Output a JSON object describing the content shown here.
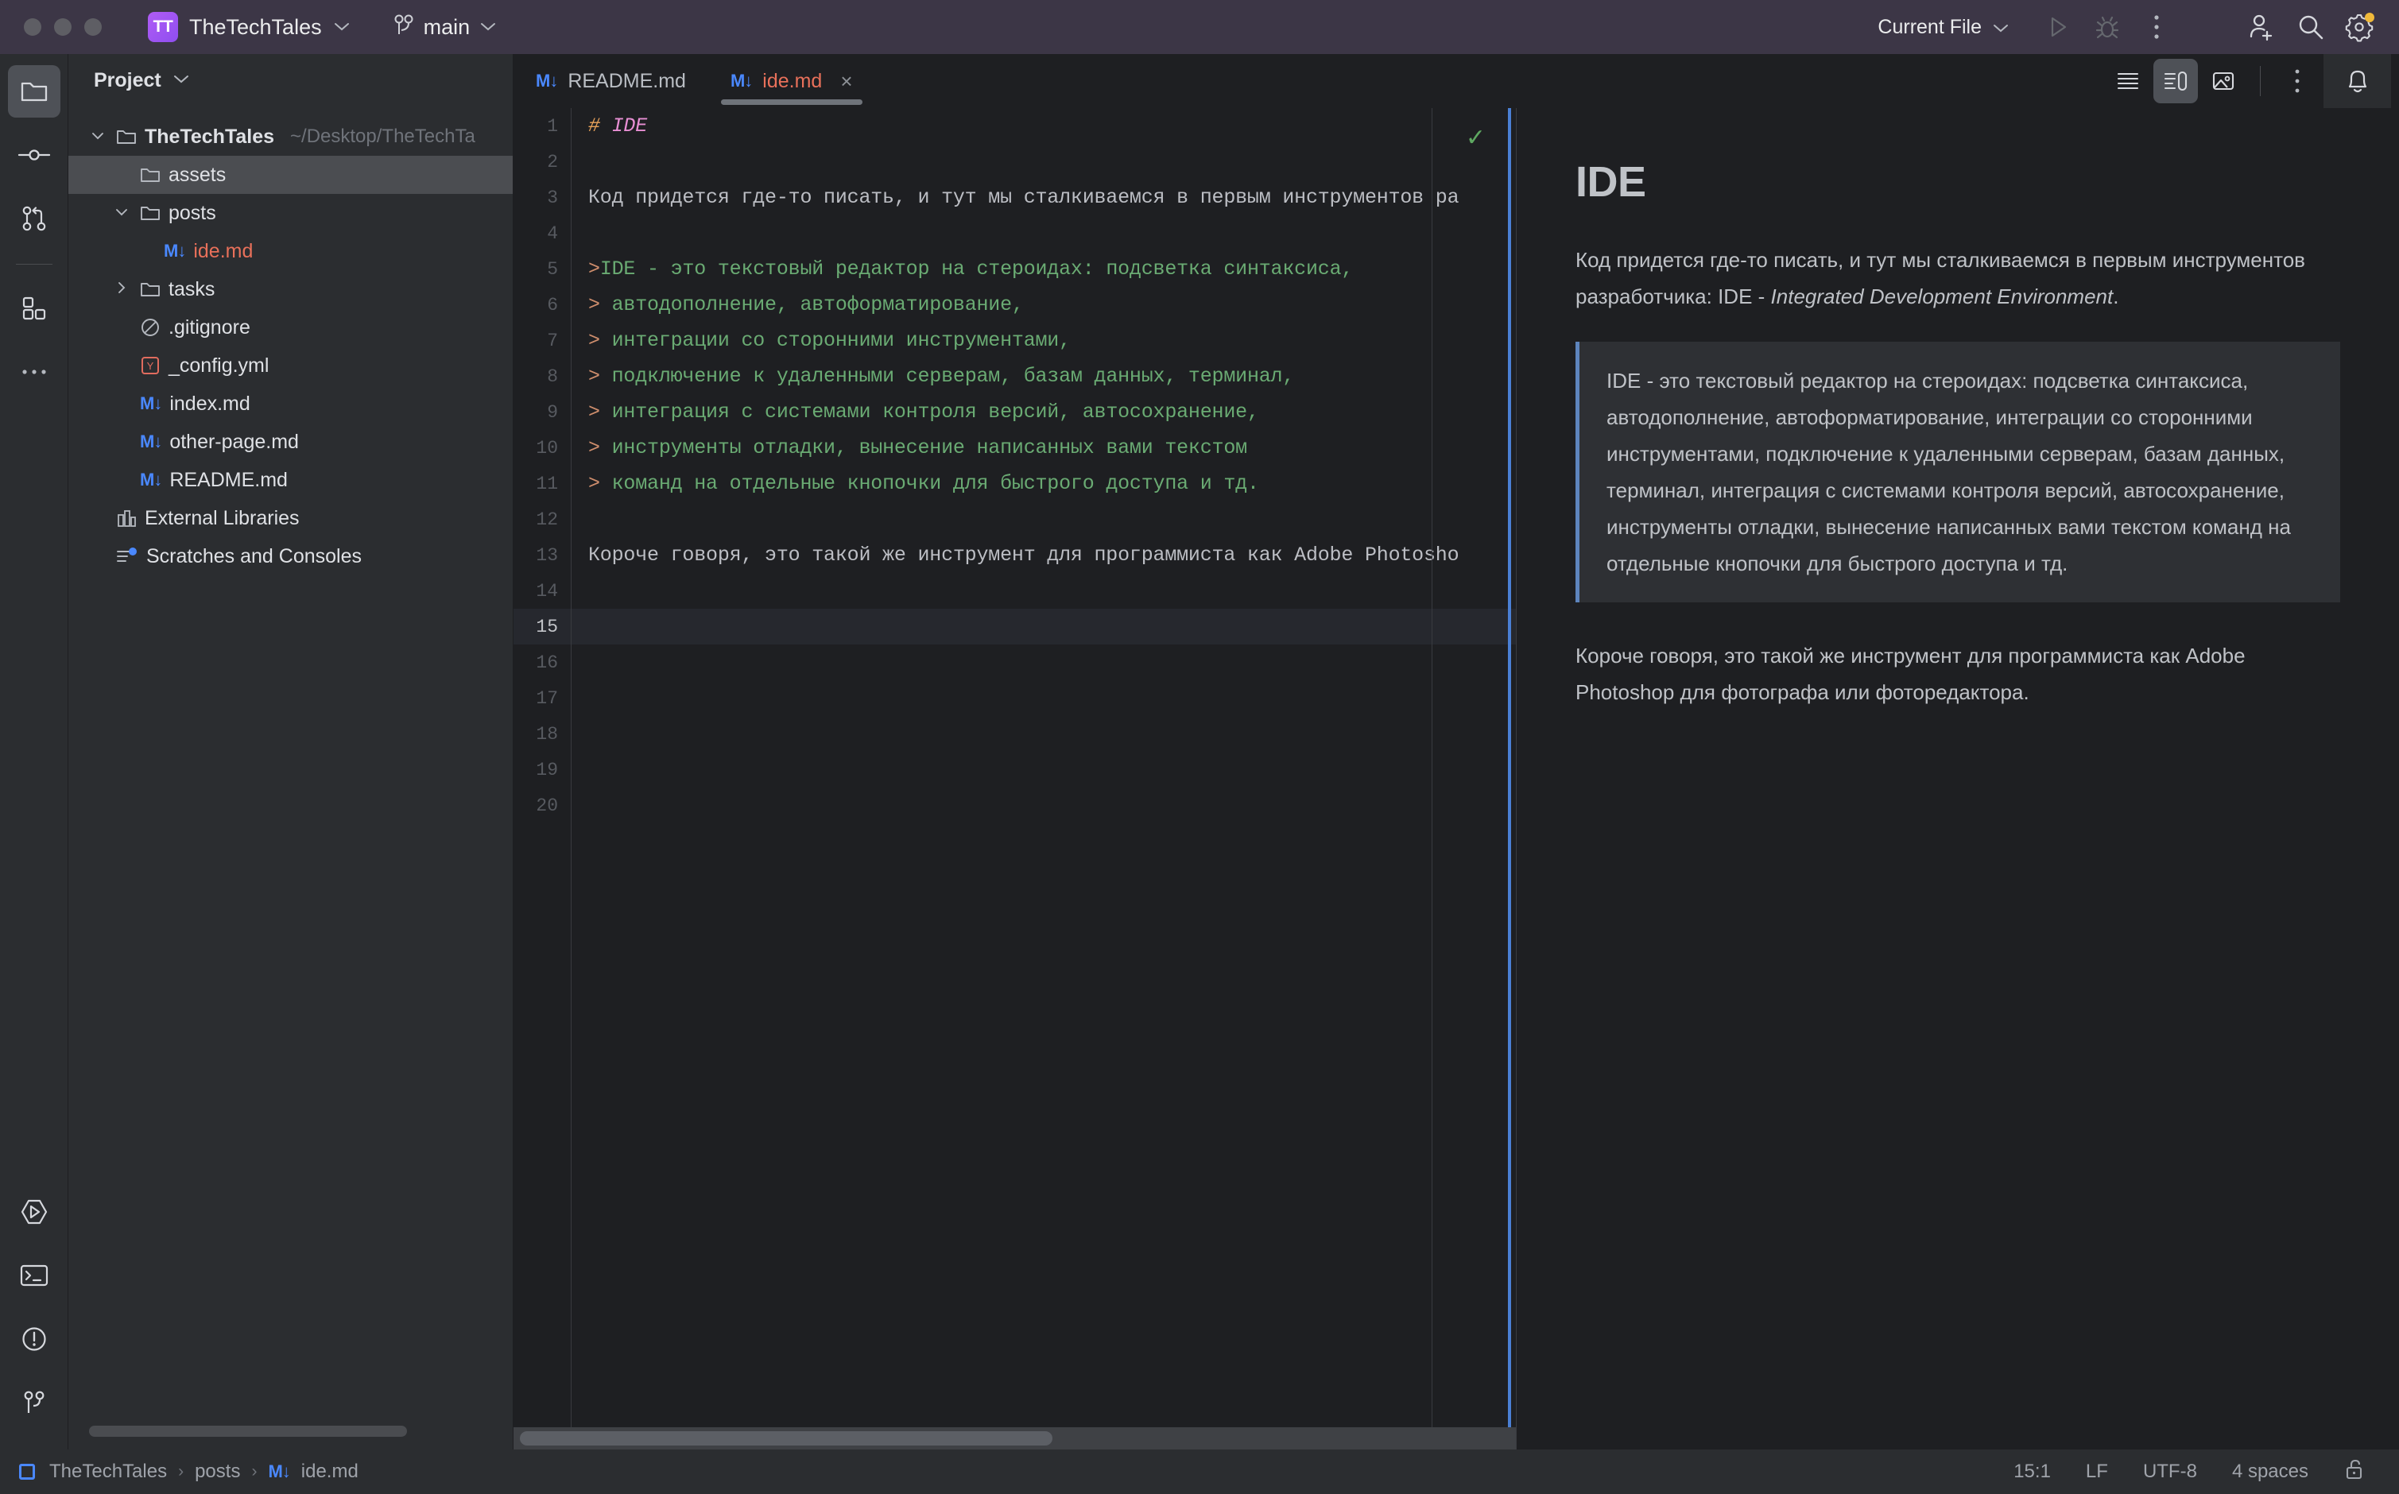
{
  "titlebar": {
    "project_badge": "TT",
    "project_name": "TheTechTales",
    "branch": "main",
    "run_config": "Current File",
    "icons": {
      "run": "run-icon",
      "debug": "debug-icon",
      "more": "more-options-icon",
      "add_user": "add-user-icon",
      "search": "search-icon",
      "settings": "settings-icon"
    }
  },
  "activity_bar": {
    "top_items": [
      {
        "name": "project-icon",
        "label": "Project"
      },
      {
        "name": "commit-icon",
        "label": "Commit"
      },
      {
        "name": "pull-requests-icon",
        "label": "Pull Requests"
      }
    ],
    "mid_items": [
      {
        "name": "plugins-icon",
        "label": "Plugins"
      },
      {
        "name": "more-tool-windows-icon",
        "label": "More"
      }
    ],
    "bottom_items": [
      {
        "name": "run-tool-icon",
        "label": "Run"
      },
      {
        "name": "terminal-icon",
        "label": "Terminal"
      },
      {
        "name": "problems-icon",
        "label": "Problems"
      },
      {
        "name": "version-control-icon",
        "label": "Version Control"
      }
    ]
  },
  "project_panel": {
    "title": "Project",
    "tree": [
      {
        "label": "TheTechTales",
        "path": "~/Desktop/TheTechTa",
        "icon": "folder-icon",
        "twist": "down",
        "indent": 0,
        "bold": true,
        "selected": false
      },
      {
        "label": "assets",
        "path": "",
        "icon": "folder-icon",
        "twist": "",
        "indent": 1,
        "bold": false,
        "selected": true
      },
      {
        "label": "posts",
        "path": "",
        "icon": "folder-icon",
        "twist": "down",
        "indent": 1,
        "bold": false,
        "selected": false
      },
      {
        "label": "ide.md",
        "path": "",
        "icon": "markdown-icon",
        "twist": "",
        "indent": 2,
        "bold": false,
        "selected": false,
        "color": "red"
      },
      {
        "label": "tasks",
        "path": "",
        "icon": "folder-icon",
        "twist": "right",
        "indent": 1,
        "bold": false,
        "selected": false
      },
      {
        "label": ".gitignore",
        "path": "",
        "icon": "gitignore-icon",
        "twist": "",
        "indent": 1,
        "bold": false,
        "selected": false
      },
      {
        "label": "_config.yml",
        "path": "",
        "icon": "yaml-icon",
        "twist": "",
        "indent": 1,
        "bold": false,
        "selected": false
      },
      {
        "label": "index.md",
        "path": "",
        "icon": "markdown-icon",
        "twist": "",
        "indent": 1,
        "bold": false,
        "selected": false
      },
      {
        "label": "other-page.md",
        "path": "",
        "icon": "markdown-icon",
        "twist": "",
        "indent": 1,
        "bold": false,
        "selected": false
      },
      {
        "label": "README.md",
        "path": "",
        "icon": "markdown-icon",
        "twist": "",
        "indent": 1,
        "bold": false,
        "selected": false
      },
      {
        "label": "External Libraries",
        "path": "",
        "icon": "libraries-icon",
        "twist": "",
        "indent": 0,
        "bold": false,
        "selected": false
      },
      {
        "label": "Scratches and Consoles",
        "path": "",
        "icon": "scratches-icon",
        "twist": "",
        "indent": 0,
        "bold": false,
        "selected": false
      }
    ]
  },
  "editor": {
    "tabs": [
      {
        "label": "README.md",
        "icon": "markdown-icon",
        "active": false,
        "closable": false
      },
      {
        "label": "ide.md",
        "icon": "markdown-icon",
        "active": true,
        "closable": true,
        "close_glyph": "×"
      }
    ],
    "toolbar": [
      {
        "name": "editor-only-icon",
        "active": false
      },
      {
        "name": "editor-and-preview-icon",
        "active": true
      },
      {
        "name": "preview-only-icon",
        "active": false
      },
      {
        "name": "more-icon",
        "active": false
      }
    ],
    "notification_icon": "bell-icon",
    "inspection_status": "✓",
    "lines": [
      {
        "n": "1",
        "segments": [
          {
            "t": "#",
            "c": "tok-hash"
          },
          {
            "t": " IDE",
            "c": "tok-h"
          }
        ]
      },
      {
        "n": "2",
        "segments": []
      },
      {
        "n": "3",
        "segments": [
          {
            "t": "Код придется где-то писать, и тут мы сталкиваемся в первым инструментов ра",
            "c": ""
          }
        ]
      },
      {
        "n": "4",
        "segments": []
      },
      {
        "n": "5",
        "segments": [
          {
            "t": ">",
            "c": "tok-gt"
          },
          {
            "t": "IDE - это текстовый редактор на стероидах: подсветка синтаксиса,",
            "c": "tok-quote"
          }
        ]
      },
      {
        "n": "6",
        "segments": [
          {
            "t": ">",
            "c": "tok-gt"
          },
          {
            "t": " автодополнение, автоформатирование,",
            "c": "tok-quote"
          }
        ]
      },
      {
        "n": "7",
        "segments": [
          {
            "t": ">",
            "c": "tok-gt"
          },
          {
            "t": " интеграции со сторонними инструментами,",
            "c": "tok-quote"
          }
        ]
      },
      {
        "n": "8",
        "segments": [
          {
            "t": ">",
            "c": "tok-gt"
          },
          {
            "t": " подключение к удаленными серверам, базам данных, терминал,",
            "c": "tok-quote"
          }
        ]
      },
      {
        "n": "9",
        "segments": [
          {
            "t": ">",
            "c": "tok-gt"
          },
          {
            "t": " интеграция с системами контроля версий, автосохранение,",
            "c": "tok-quote"
          }
        ]
      },
      {
        "n": "10",
        "segments": [
          {
            "t": ">",
            "c": "tok-gt"
          },
          {
            "t": " инструменты отладки, вынесение написанных вами текстом",
            "c": "tok-quote"
          }
        ]
      },
      {
        "n": "11",
        "segments": [
          {
            "t": ">",
            "c": "tok-gt"
          },
          {
            "t": " команд на отдельные кнопочки для быстрого доступа и тд.",
            "c": "tok-quote"
          }
        ]
      },
      {
        "n": "12",
        "segments": []
      },
      {
        "n": "13",
        "segments": [
          {
            "t": "Короче говоря, это такой же инструмент для программиста как Adobe Photosho",
            "c": ""
          }
        ]
      },
      {
        "n": "14",
        "segments": []
      },
      {
        "n": "15",
        "segments": [],
        "current": true
      },
      {
        "n": "16",
        "segments": []
      },
      {
        "n": "17",
        "segments": []
      },
      {
        "n": "18",
        "segments": []
      },
      {
        "n": "19",
        "segments": []
      },
      {
        "n": "20",
        "segments": []
      }
    ]
  },
  "preview": {
    "heading": "IDE",
    "para1_a": "Код придется где-то писать, и тут мы сталкиваемся в первым инструментов разработчика: IDE - ",
    "para1_em": "Integrated Development Environment",
    "para1_b": ".",
    "quote": "IDE - это текстовый редактор на стероидах: подсветка синтаксиса, автодополнение, автоформатирование, интеграции со сторонними инструментами, подключение к удаленными серверам, базам данных, терминал, интеграция с системами контроля версий, автосохранение, инструменты отладки, вынесение написанных вами текстом команд на отдельные кнопочки для быстрого доступа и тд.",
    "para2": "Короче говоря, это такой же инструмент для программиста как Adobe Photoshop для фотографа или фоторедактора."
  },
  "statusbar": {
    "crumb1": "TheTechTales",
    "crumb2": "posts",
    "crumb3": "ide.md",
    "sep": "›",
    "caret": "15:1",
    "line_sep": "LF",
    "encoding": "UTF-8",
    "indent": "4 spaces",
    "lock_icon": "unlocked-icon"
  },
  "colors": {
    "accent_purple": "#9b5cf0",
    "markdown_blue": "#4a88ff",
    "active_file_red": "#e8705a",
    "quote_green": "#6aab73",
    "heading_pink": "#e88fd4",
    "quote_border": "#5d84bd",
    "titlebar_bg": "#3c3646",
    "panel_bg": "#2b2d30",
    "editor_bg": "#1e1f22"
  }
}
